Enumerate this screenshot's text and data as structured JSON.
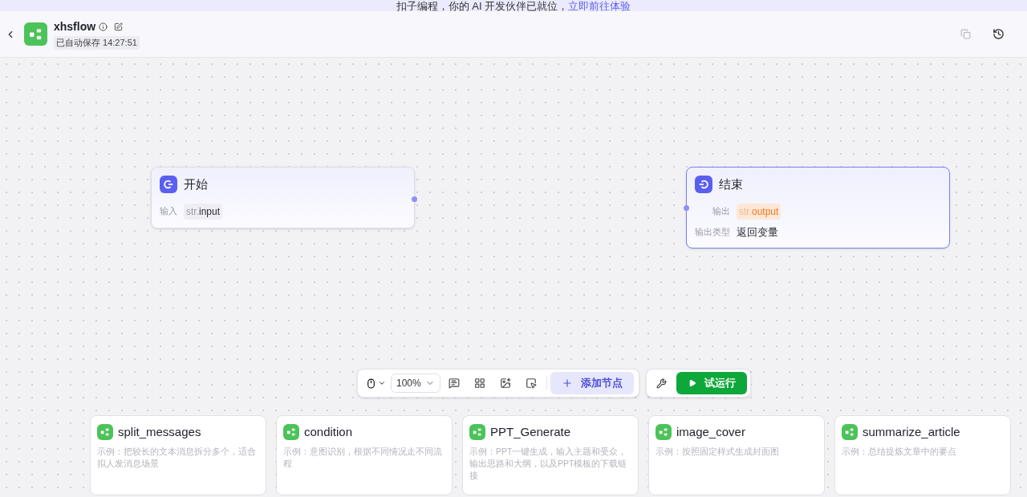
{
  "banner": {
    "text": "扣子编程，你的 AI 开发伙伴已就位，",
    "link": "立即前往体验"
  },
  "header": {
    "title": "xhsflow",
    "saved": "已自动保存 14:27:51"
  },
  "nodes": [
    {
      "kind": "start",
      "title": "开始",
      "selected": false,
      "rows": [
        {
          "kind": "var",
          "label": "输入",
          "type": "str.",
          "value": "input"
        }
      ]
    },
    {
      "kind": "end",
      "title": "结束",
      "selected": true,
      "rows": [
        {
          "kind": "var",
          "label": "输出",
          "type": "str.",
          "value": "output"
        },
        {
          "kind": "text",
          "label": "输出类型",
          "value": "返回变量"
        }
      ]
    }
  ],
  "toolbar": {
    "zoom": "100%",
    "add_label": "添加节点",
    "run_label": "试运行"
  },
  "templates": [
    {
      "title": "split_messages",
      "description": "示例：把较长的文本消息拆分多个，适合拟人发消息场景"
    },
    {
      "title": "condition",
      "description": "示例：意图识别，根据不同情况走不同流程"
    },
    {
      "title": "PPT_Generate",
      "description": "示例：PPT一键生成，输入主题和受众，输出思路和大纲，以及PPT模板的下载链接"
    },
    {
      "title": "image_cover",
      "description": "示例：按照固定样式生成封面图"
    },
    {
      "title": "summarize_article",
      "description": "示例：总结提炼文章中的要点"
    }
  ]
}
